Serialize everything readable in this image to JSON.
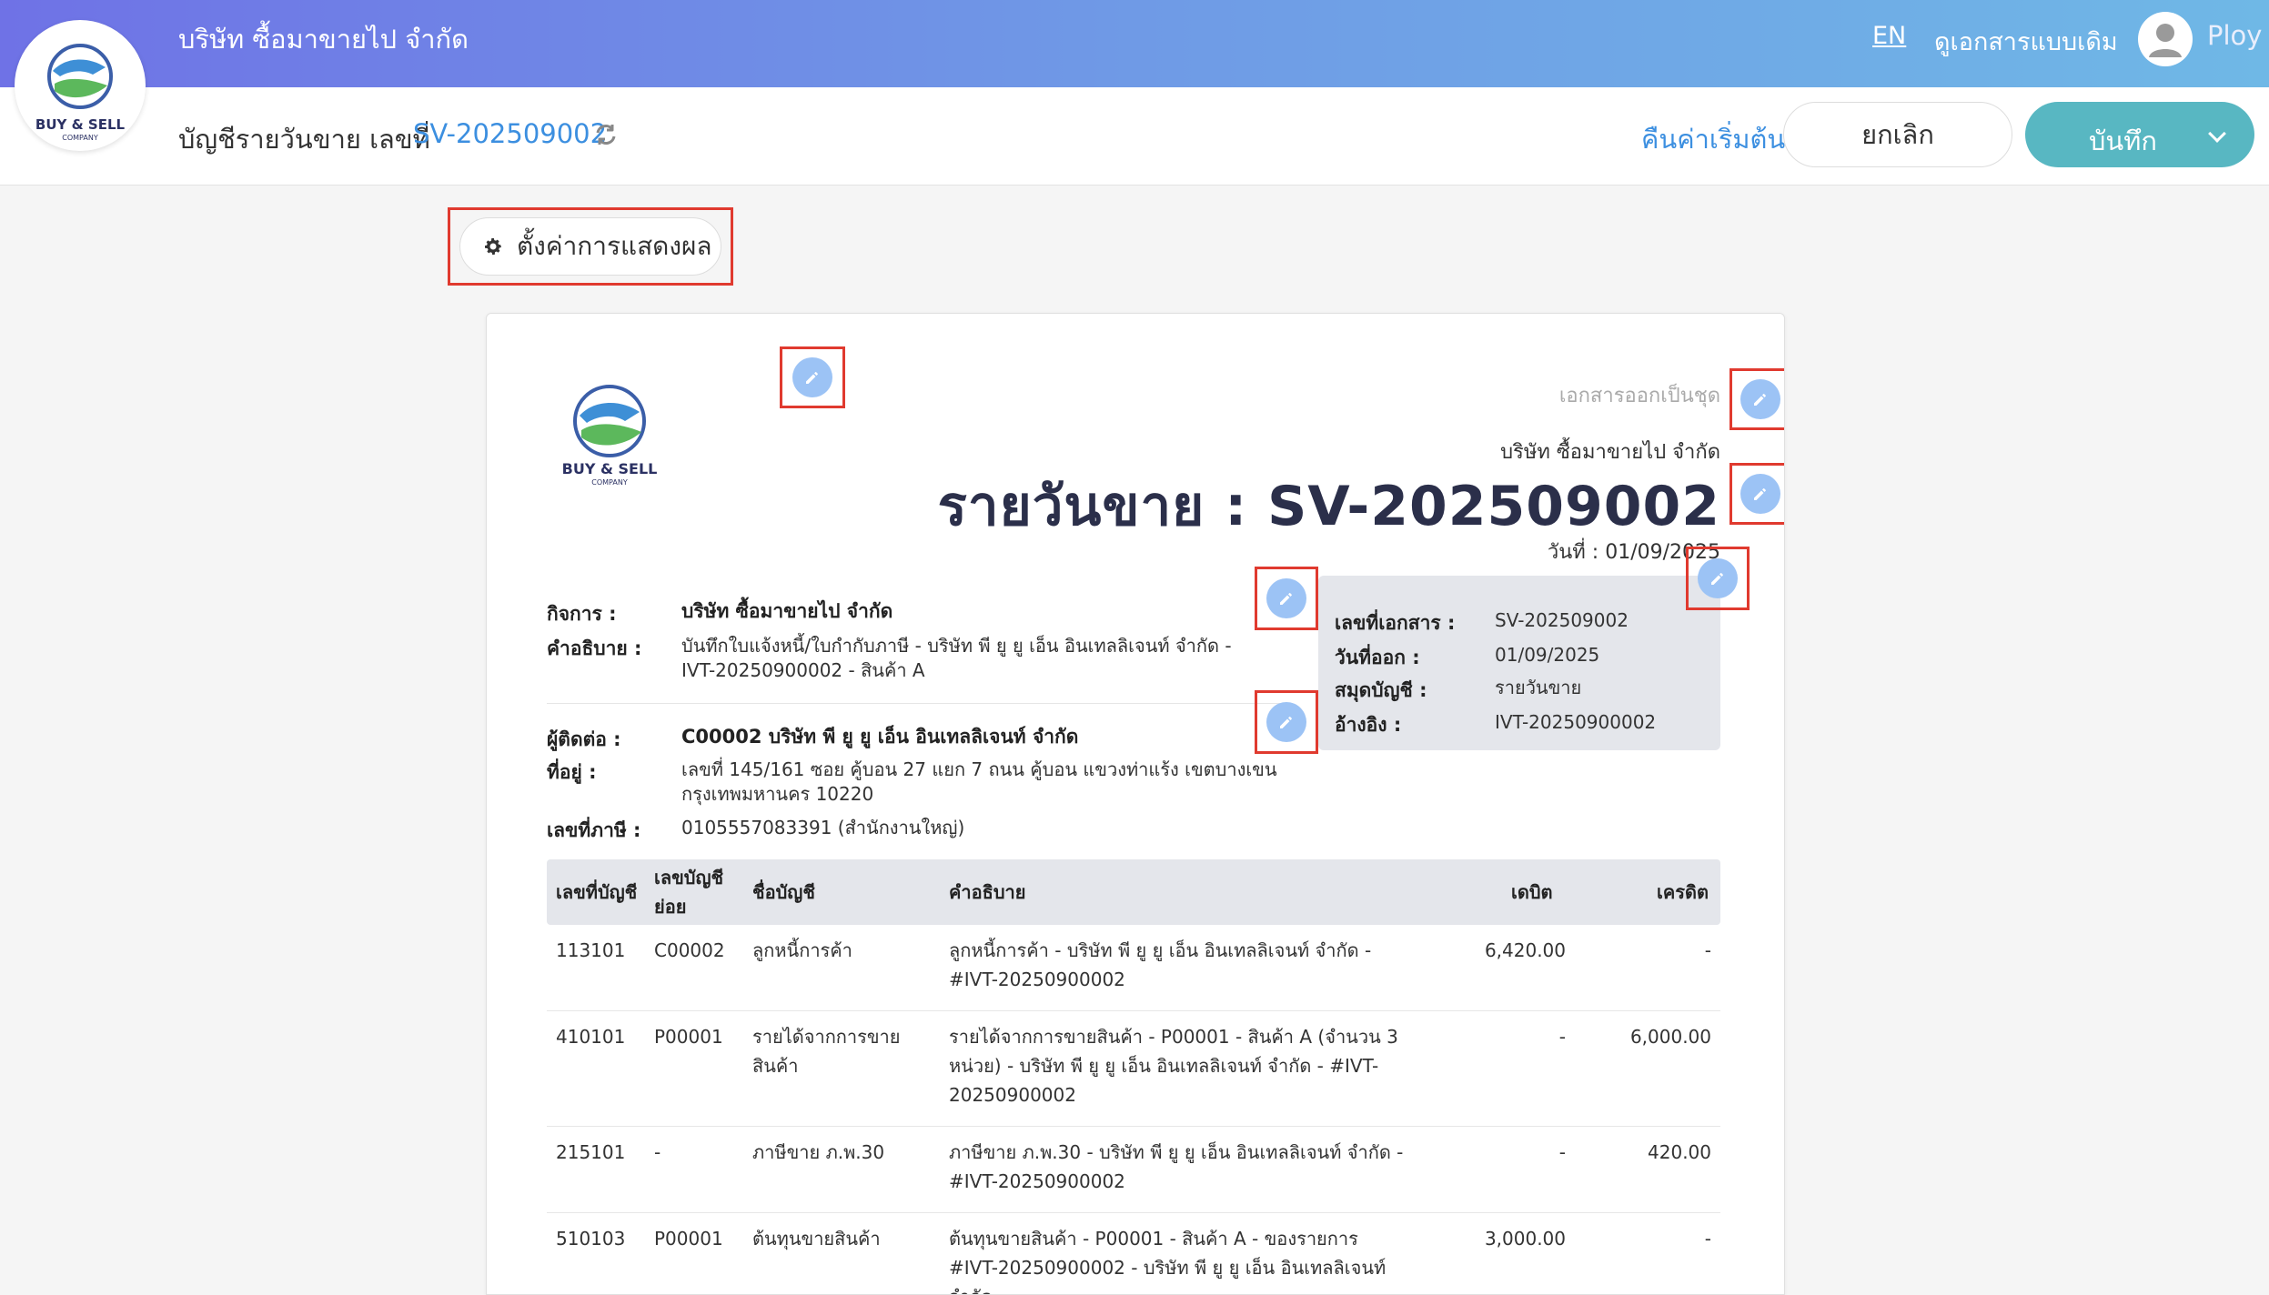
{
  "header": {
    "company_name": "บริษัท ซื้อมาขายไป จำกัด",
    "lang": "EN",
    "old_doc_link": "ดูเอกสารแบบเดิม",
    "username": "Ploy",
    "logo_text": "BUY & SELL",
    "logo_subtext": "COMPANY"
  },
  "toolbar": {
    "title_prefix": "บัญชีรายวันขาย เลขที่",
    "doc_number": "SV-202509002",
    "reset_label": "คืนค่าเริ่มต้น",
    "cancel_label": "ยกเลิก",
    "save_label": "บันทึก"
  },
  "display_settings_label": "ตั้งค่าการแสดงผล",
  "document": {
    "copy_note": "เอกสารออกเป็นชุด",
    "issuer": "บริษัท ซื้อมาขายไป จำกัด",
    "title": "รายวันขาย : SV-202509002",
    "date_line": "วันที่ : 01/09/2025",
    "business_label": "กิจการ :",
    "business_value": "บริษัท ซื้อมาขายไป จำกัด",
    "desc_label": "คำอธิบาย :",
    "desc_value": "บันทึกใบแจ้งหนี้/ใบกำกับภาษี - บริษัท พี ยู ยู เอ็น อินเทลลิเจนท์ จำกัด - IVT-20250900002 - สินค้า A",
    "contact_label": "ผู้ติดต่อ :",
    "contact_value": "C00002 บริษัท พี ยู ยู เอ็น อินเทลลิเจนท์ จำกัด",
    "address_label": "ที่อยู่ :",
    "address_value": "เลขที่ 145/161    ซอย คู้บอน 27 แยก 7 ถนน คู้บอน  แขวงท่าแร้ง เขตบางเขน กรุงเทพมหานคร 10220",
    "taxid_label": "เลขที่ภาษี :",
    "taxid_value": "0105557083391 (สำนักงานใหญ่)",
    "right": {
      "docno_label": "เลขที่เอกสาร :",
      "docno_value": "SV-202509002",
      "issue_label": "วันที่ออก :",
      "issue_value": "01/09/2025",
      "book_label": "สมุดบัญชี :",
      "book_value": "รายวันขาย",
      "ref_label": "อ้างอิง :",
      "ref_value": "IVT-20250900002"
    }
  },
  "table": {
    "headers": [
      "เลขที่บัญชี",
      "เลขบัญชีย่อย",
      "ชื่อบัญชี",
      "คำอธิบาย",
      "เดบิต",
      "เครดิต"
    ],
    "rows": [
      {
        "acct": "113101",
        "sub": "C00002",
        "name": "ลูกหนี้การค้า",
        "desc": "ลูกหนี้การค้า - บริษัท พี ยู ยู เอ็น อินเทลลิเจนท์ จำกัด - #IVT-20250900002",
        "debit": "6,420.00",
        "credit": "-"
      },
      {
        "acct": "410101",
        "sub": "P00001",
        "name": "รายได้จากการขายสินค้า",
        "desc": "รายได้จากการขายสินค้า - P00001 - สินค้า A (จำนวน 3 หน่วย) - บริษัท พี ยู ยู เอ็น อินเทลลิเจนท์ จำกัด - #IVT-20250900002",
        "debit": "-",
        "credit": "6,000.00"
      },
      {
        "acct": "215101",
        "sub": "-",
        "name": "ภาษีขาย ภ.พ.30",
        "desc": "ภาษีขาย ภ.พ.30 - บริษัท พี ยู ยู เอ็น อินเทลลิเจนท์ จำกัด - #IVT-20250900002",
        "debit": "-",
        "credit": "420.00"
      },
      {
        "acct": "510103",
        "sub": "P00001",
        "name": "ต้นทุนขายสินค้า",
        "desc": "ต้นทุนขายสินค้า - P00001 - สินค้า A - ของรายการ #IVT-20250900002 - บริษัท พี ยู ยู เอ็น อินเทลลิเจนท์ จำกัด",
        "debit": "3,000.00",
        "credit": "-"
      }
    ]
  },
  "colors": {
    "accent": "#3c8fe0",
    "save_button": "#58b7c2",
    "highlight_box": "#e03a2f",
    "edit_icon_bg": "#9cc3f5"
  }
}
